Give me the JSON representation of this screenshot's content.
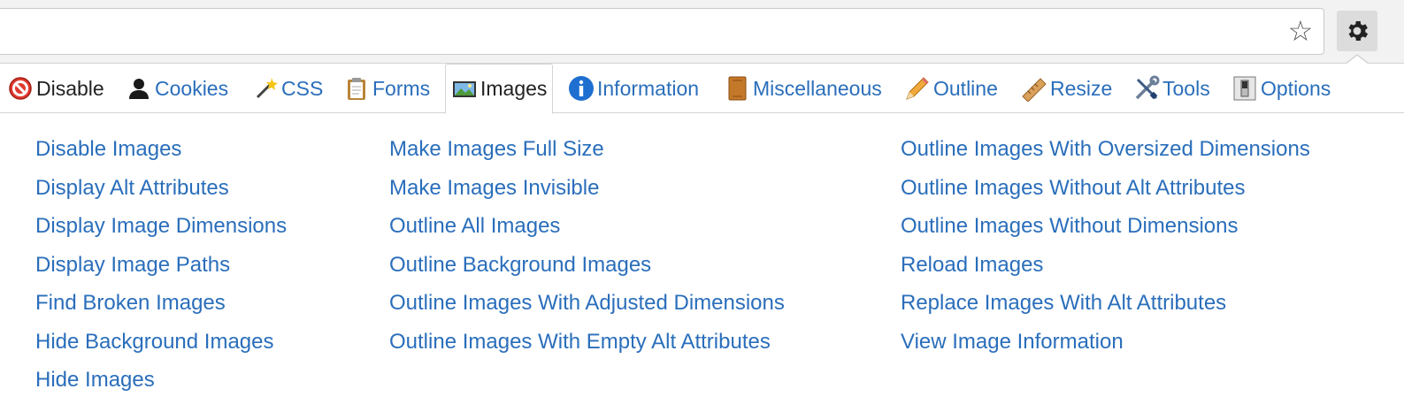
{
  "toolbar": {
    "star_icon": "star-icon",
    "gear_icon": "gear-icon"
  },
  "tabs": [
    {
      "label": "Disable",
      "icon": "no-entry-icon"
    },
    {
      "label": "Cookies",
      "icon": "person-icon"
    },
    {
      "label": "CSS",
      "icon": "magic-wand-icon"
    },
    {
      "label": "Forms",
      "icon": "clipboard-icon"
    },
    {
      "label": "Images",
      "icon": "picture-icon",
      "active": true
    },
    {
      "label": "Information",
      "icon": "info-icon"
    },
    {
      "label": "Miscellaneous",
      "icon": "book-icon"
    },
    {
      "label": "Outline",
      "icon": "pencil-icon"
    },
    {
      "label": "Resize",
      "icon": "ruler-icon"
    },
    {
      "label": "Tools",
      "icon": "wrench-screwdriver-icon"
    },
    {
      "label": "Options",
      "icon": "switch-icon"
    }
  ],
  "columns": [
    [
      "Disable Images",
      "Display Alt Attributes",
      "Display Image Dimensions",
      "Display Image Paths",
      "Find Broken Images",
      "Hide Background Images",
      "Hide Images"
    ],
    [
      "Make Images Full Size",
      "Make Images Invisible",
      "Outline All Images",
      "Outline Background Images",
      "Outline Images With Adjusted Dimensions",
      "Outline Images With Empty Alt Attributes"
    ],
    [
      "Outline Images With Oversized Dimensions",
      "Outline Images Without Alt Attributes",
      "Outline Images Without Dimensions",
      "Reload Images",
      "Replace Images With Alt Attributes",
      "View Image Information"
    ]
  ],
  "colors": {
    "link": "#2a6ebb",
    "text": "#222222",
    "border": "#d4d4d4",
    "chrome": "#f2f2f2"
  }
}
